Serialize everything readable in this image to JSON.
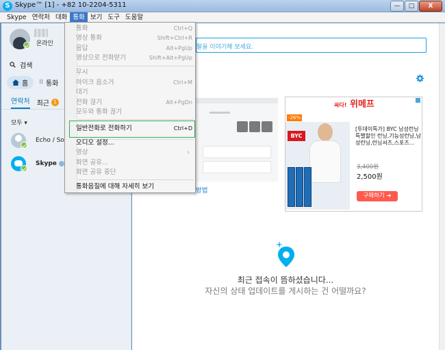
{
  "window": {
    "title": "Skype™ [1] - +82 10-2204-5311",
    "logo_letter": "S",
    "minimize": "—",
    "maximize": "□",
    "close": "X"
  },
  "menubar": [
    "Skype",
    "연락처",
    "대화",
    "통화",
    "보기",
    "도구",
    "도움말"
  ],
  "sidebar": {
    "status": "온라인",
    "search": "검색",
    "home": "홈",
    "call_tab": "통화",
    "tab_contacts": "연락처",
    "tab_recent": "최근",
    "recent_badge": "1",
    "filter": "모두",
    "contacts": [
      {
        "name": "Echo / Sou"
      },
      {
        "name": "Skype"
      }
    ]
  },
  "main": {
    "mood_placeholder": "팔을 이야기해 보세요.",
    "how_link": "방법",
    "empty_title": "최근 접속이 뜸하셨습니다...",
    "empty_subtitle": "자신의 상태 업데이트를 게시하는 건 어떨까요?"
  },
  "ad": {
    "brand_prefix": "싸다!",
    "brand": "위메프",
    "discount": "-26%",
    "logo": "BYC",
    "desc": "[투데이특가] BYC 남성런닝 특별할인 런닝,기능성런닝,남성런닝,런닝셔츠,스포츠...",
    "old_price": "3,400원",
    "price": "2,500원",
    "buy": "구매하기"
  },
  "dropdown": {
    "items": [
      {
        "label": "통화",
        "shortcut": "Ctrl+Q",
        "enabled": false
      },
      {
        "label": "영상 통화",
        "shortcut": "Shift+Ctrl+R",
        "enabled": false
      },
      {
        "label": "응답",
        "shortcut": "Alt+PgUp",
        "enabled": false
      },
      {
        "label": "영상으로 전화받기",
        "shortcut": "Shift+Alt+PgUp",
        "enabled": false
      },
      {
        "label": "무시",
        "shortcut": "",
        "enabled": false
      },
      {
        "label": "마이크 음소거",
        "shortcut": "Ctrl+M",
        "enabled": false
      },
      {
        "label": "대기",
        "shortcut": "",
        "enabled": false
      },
      {
        "label": "전화 끊기",
        "shortcut": "Alt+PgDn",
        "enabled": false
      },
      {
        "label": "모두와 통화 끊기",
        "shortcut": "",
        "enabled": false
      },
      {
        "label": "일반전화로 전화하기",
        "shortcut": "Ctrl+D",
        "enabled": true
      },
      {
        "label": "오디오 설정...",
        "shortcut": "",
        "enabled": true
      },
      {
        "label": "영상",
        "shortcut": "",
        "enabled": false
      },
      {
        "label": "화면 공유...",
        "shortcut": "",
        "enabled": false
      },
      {
        "label": "화면 공유 중단",
        "shortcut": "",
        "enabled": false
      },
      {
        "label": "통화음질에 대해 자세히 보기",
        "shortcut": "",
        "enabled": true
      }
    ],
    "submenu_arrow": "›"
  },
  "colors": {
    "accent": "#00aff0",
    "menu_highlight": "#3c78c8",
    "highlight_box": "#2bb24c",
    "ad_red": "#e3251f"
  }
}
